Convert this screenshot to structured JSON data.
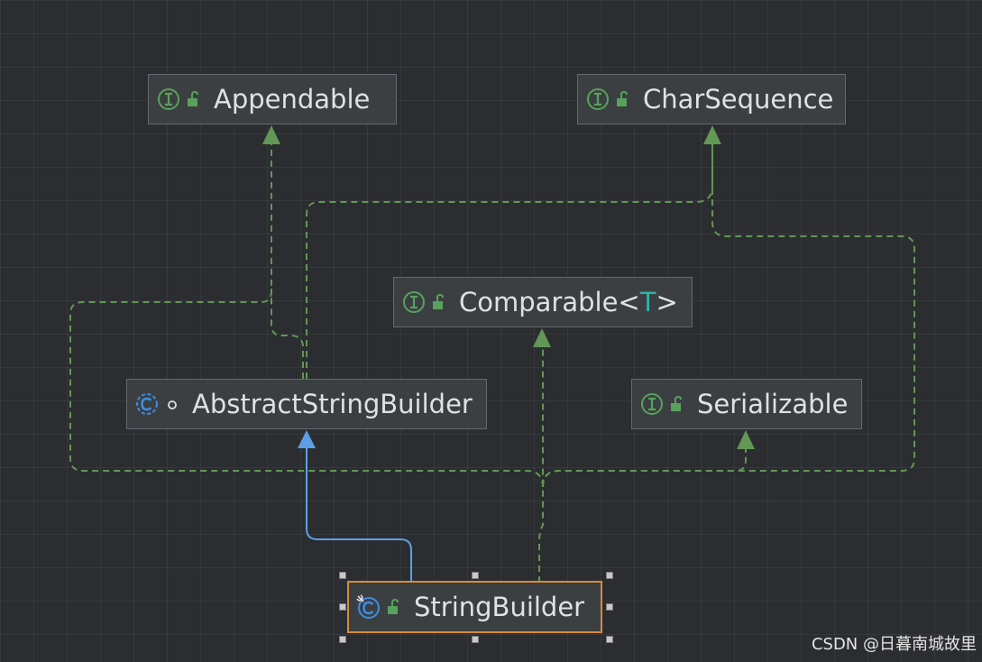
{
  "diagram": {
    "nodes": [
      {
        "id": "appendable",
        "kind": "interface",
        "visibility": "public",
        "name": "Appendable"
      },
      {
        "id": "charsequence",
        "kind": "interface",
        "visibility": "public",
        "name": "CharSequence"
      },
      {
        "id": "comparable",
        "kind": "interface",
        "visibility": "public",
        "name": "Comparable",
        "type_param": "T"
      },
      {
        "id": "abstractstringbuilder",
        "kind": "abstract-class",
        "visibility": "package-private",
        "name": "AbstractStringBuilder"
      },
      {
        "id": "serializable",
        "kind": "interface",
        "visibility": "public",
        "name": "Serializable"
      },
      {
        "id": "stringbuilder",
        "kind": "final-class",
        "visibility": "public",
        "name": "StringBuilder",
        "selected": true
      }
    ],
    "edges": [
      {
        "from": "stringbuilder",
        "to": "abstractstringbuilder",
        "type": "extends"
      },
      {
        "from": "stringbuilder",
        "to": "comparable",
        "type": "implements"
      },
      {
        "from": "stringbuilder",
        "to": "serializable",
        "type": "implements"
      },
      {
        "from": "stringbuilder",
        "to": "charsequence",
        "type": "implements"
      },
      {
        "from": "stringbuilder",
        "to": "appendable",
        "type": "implements"
      },
      {
        "from": "abstractstringbuilder",
        "to": "appendable",
        "type": "implements"
      },
      {
        "from": "abstractstringbuilder",
        "to": "charsequence",
        "type": "implements"
      }
    ],
    "colors": {
      "implements": "#629755",
      "extends": "#5c9fe6",
      "selection_border": "#d88a3e",
      "interface_icon": "#57a25c",
      "class_icon": "#3d8ee6",
      "type_param": "#2fb3ad"
    }
  },
  "watermark": "CSDN @日暮南城故里"
}
